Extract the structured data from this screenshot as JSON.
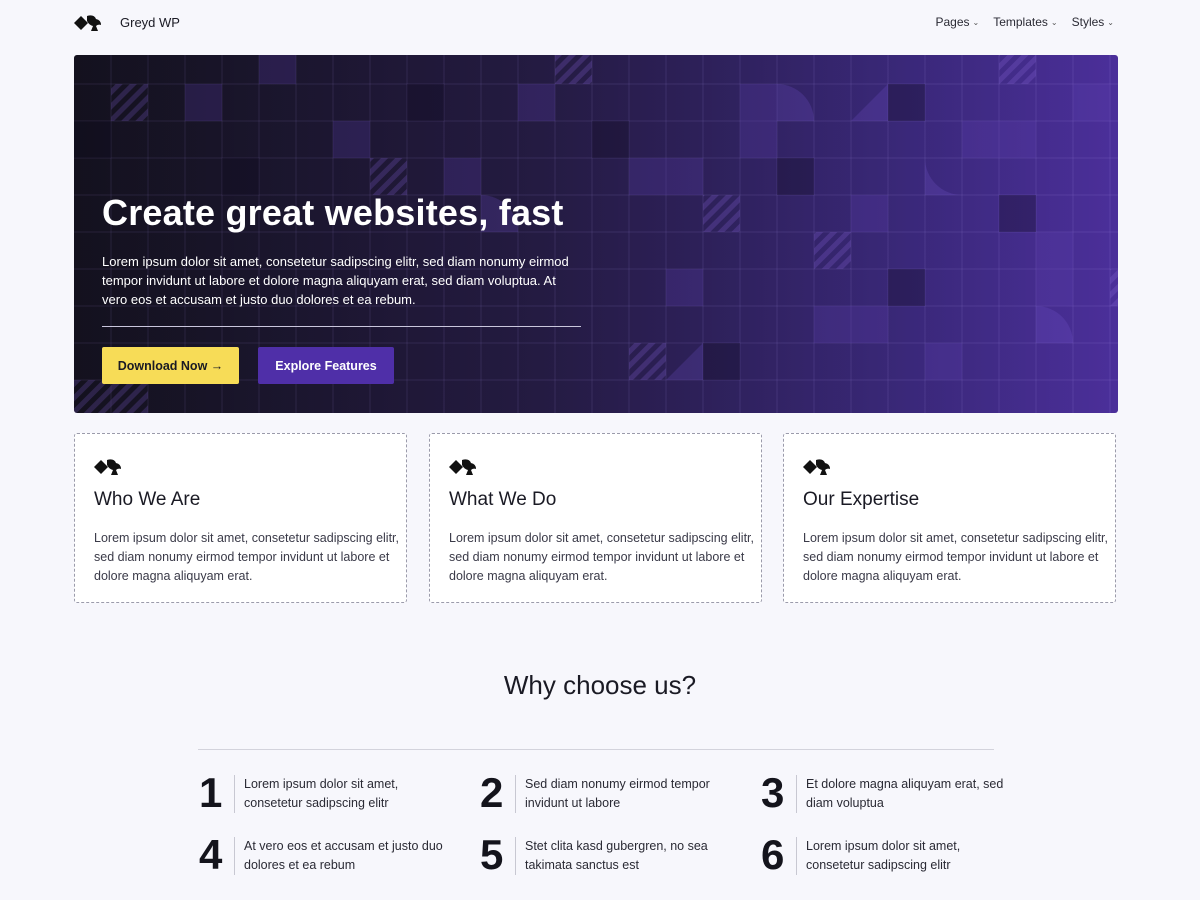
{
  "header": {
    "site_title": "Greyd WP",
    "nav": [
      {
        "label": "Pages"
      },
      {
        "label": "Templates"
      },
      {
        "label": "Styles"
      }
    ]
  },
  "hero": {
    "title": "Create great websites, fast",
    "text": "Lorem ipsum dolor sit amet, consetetur sadipscing elitr, sed diam nonumy eirmod tempor invidunt ut labore et dolore magna aliquyam erat, sed diam voluptua. At vero eos et accusam et justo duo dolores et ea rebum.",
    "primary_button": "Download Now →",
    "secondary_button": "Explore Features"
  },
  "cards": [
    {
      "title": "Who We Are",
      "text": "Lorem ipsum dolor sit amet, consetetur sadipscing elitr, sed diam nonumy eirmod tempor invidunt ut labore et dolore magna aliquyam erat."
    },
    {
      "title": "What We Do",
      "text": "Lorem ipsum dolor sit amet, consetetur sadipscing elitr, sed diam nonumy eirmod tempor invidunt ut labore et dolore magna aliquyam erat."
    },
    {
      "title": "Our Expertise",
      "text": "Lorem ipsum dolor sit amet, consetetur sadipscing elitr, sed diam nonumy eirmod tempor invidunt ut labore et dolore magna aliquyam erat."
    }
  ],
  "why": {
    "title": "Why choose us?",
    "features": [
      {
        "number": "1",
        "text": "Lorem ipsum dolor sit amet, consetetur sadipscing elitr"
      },
      {
        "number": "2",
        "text": "Sed diam nonumy eirmod tempor invidunt ut labore"
      },
      {
        "number": "3",
        "text": "Et dolore magna aliquyam erat, sed diam voluptua"
      },
      {
        "number": "4",
        "text": "At vero eos et accusam et justo duo dolores et ea rebum"
      },
      {
        "number": "5",
        "text": "Stet clita kasd gubergren, no sea takimata sanctus est"
      },
      {
        "number": "6",
        "text": "Lorem ipsum dolor sit amet, consetetur sadipscing elitr"
      }
    ]
  },
  "colors": {
    "background": "#f7f7fc",
    "hero_dark": "#1a1728",
    "hero_purple": "#4b2f9a",
    "accent_yellow": "#f7dc57",
    "accent_purple": "#4f2fa8"
  },
  "icons": {
    "logo": "greyd-logo-icon",
    "card_icon": "greyd-logo-icon",
    "nav_chevron": "chevron-down-icon"
  }
}
